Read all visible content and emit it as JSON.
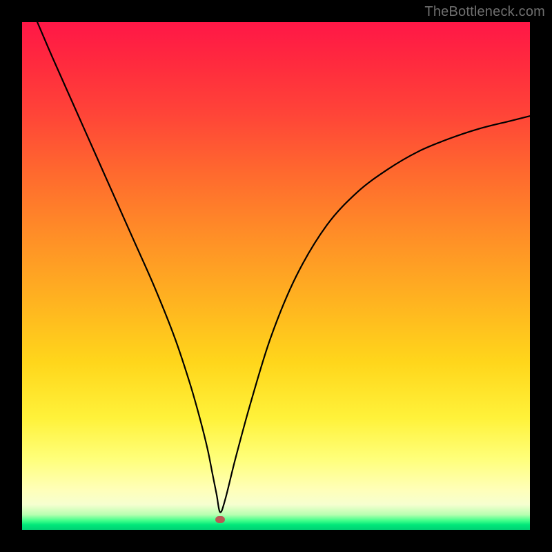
{
  "watermark": "TheBottleneck.com",
  "chart_data": {
    "type": "line",
    "title": "",
    "xlabel": "",
    "ylabel": "",
    "xlim": [
      0,
      100
    ],
    "ylim": [
      0,
      100
    ],
    "grid": false,
    "marker": {
      "x": 39,
      "y": 2
    },
    "series": [
      {
        "name": "curve",
        "x": [
          3,
          6,
          10,
          14,
          18,
          22,
          26,
          30,
          33,
          35,
          36.5,
          37.5,
          38.3,
          39,
          40,
          42,
          45,
          49,
          54,
          60,
          66,
          72,
          78,
          84,
          90,
          96,
          100
        ],
        "y": [
          100,
          93,
          84,
          75,
          66,
          57,
          48,
          38,
          29,
          22,
          16,
          11,
          7,
          3.5,
          6,
          14,
          25,
          38,
          50,
          60,
          66.5,
          71,
          74.5,
          77,
          79,
          80.5,
          81.5
        ]
      }
    ],
    "colors": {
      "curve": "#000000",
      "marker": "#b85a55",
      "gradient_top": "#ff1747",
      "gradient_bottom": "#00d074"
    }
  }
}
